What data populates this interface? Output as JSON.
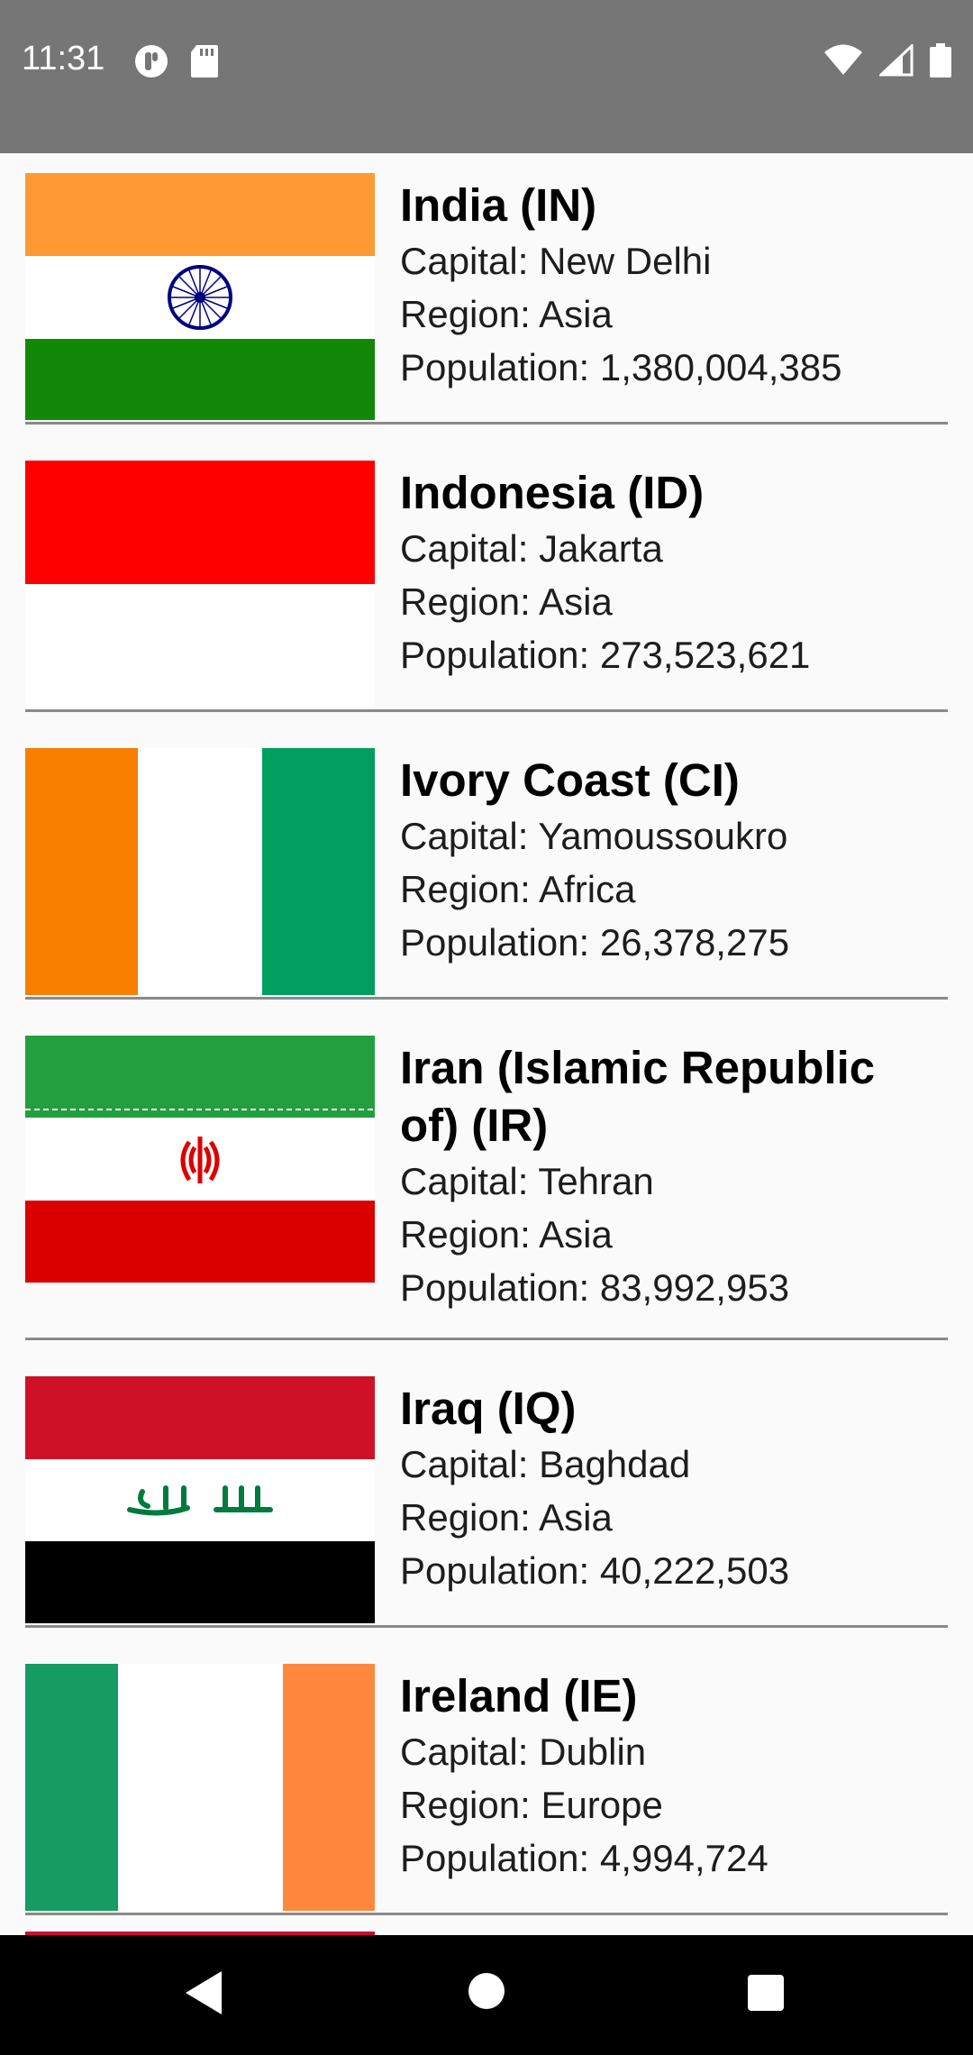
{
  "status_bar": {
    "time": "11:31",
    "left_icons": [
      "notification-icon",
      "sd-card-icon"
    ],
    "right_icons": [
      "wifi-icon",
      "signal-icon",
      "battery-icon"
    ]
  },
  "countries": [
    {
      "name": "India (IN)",
      "capital_label": "Capital: ",
      "capital": "New Delhi",
      "region_label": "Region: ",
      "region": "Asia",
      "population_label": "Population: ",
      "population": "1,380,004,385",
      "flag": "india-flag"
    },
    {
      "name": "Indonesia (ID)",
      "capital_label": "Capital: ",
      "capital": "Jakarta",
      "region_label": "Region: ",
      "region": "Asia",
      "population_label": "Population: ",
      "population": "273,523,621",
      "flag": "indonesia-flag"
    },
    {
      "name": "Ivory Coast (CI)",
      "capital_label": "Capital: ",
      "capital": "Yamoussoukro",
      "region_label": "Region: ",
      "region": "Africa",
      "population_label": "Population: ",
      "population": "26,378,275",
      "flag": "ivory-coast-flag"
    },
    {
      "name": "Iran (Islamic Republic of) (IR)",
      "capital_label": "Capital: ",
      "capital": "Tehran",
      "region_label": "Region: ",
      "region": "Asia",
      "population_label": "Population: ",
      "population": "83,992,953",
      "flag": "iran-flag"
    },
    {
      "name": "Iraq (IQ)",
      "capital_label": "Capital: ",
      "capital": "Baghdad",
      "region_label": "Region: ",
      "region": "Asia",
      "population_label": "Population: ",
      "population": "40,222,503",
      "flag": "iraq-flag"
    },
    {
      "name": "Ireland (IE)",
      "capital_label": "Capital: ",
      "capital": "Dublin",
      "region_label": "Region: ",
      "region": "Europe",
      "population_label": "Population: ",
      "population": "4,994,724",
      "flag": "ireland-flag"
    }
  ],
  "nav_bar": {
    "buttons": [
      "back-icon",
      "home-icon",
      "recents-icon"
    ]
  },
  "colors": {
    "status_bar": "#767676",
    "list_background": "#fafafa",
    "divider": "#8a8a8a",
    "nav_bar": "#000000"
  }
}
